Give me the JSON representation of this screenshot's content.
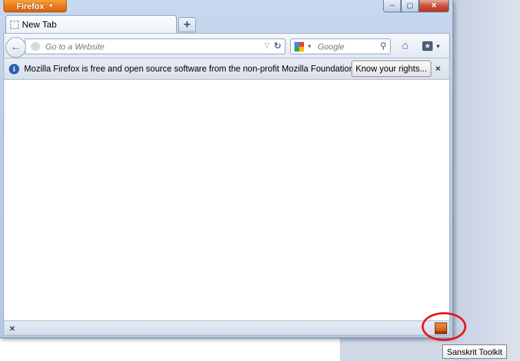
{
  "app": {
    "menu_button_label": "Firefox"
  },
  "window_controls": {
    "minimize": "─",
    "maximize": "▢",
    "close": "✕"
  },
  "tabs": [
    {
      "label": "New Tab"
    }
  ],
  "new_tab_symbol": "+",
  "navbar": {
    "url_placeholder": "Go to a Website",
    "search_placeholder": "Google",
    "search_engine_icon": "google-icon",
    "icons": [
      "back-arrow-icon",
      "globe-icon",
      "dropdown-icon",
      "reload-icon",
      "magnifier-icon",
      "home-icon",
      "bookmarks-icon"
    ]
  },
  "notification": {
    "text": "Mozilla Firefox is free and open source software from the non-profit Mozilla Foundation.",
    "button_label": "Know your rights...",
    "close_symbol": "×"
  },
  "addon_bar": {
    "close_symbol": "×",
    "addon_icon_text": "Sanskrit"
  },
  "tooltip": {
    "text": "Sanskrit Toolkit"
  },
  "colors": {
    "firefox_button": "#e8791a",
    "highlight_ring": "#e8151b",
    "info_icon": "#2c5fb2"
  }
}
